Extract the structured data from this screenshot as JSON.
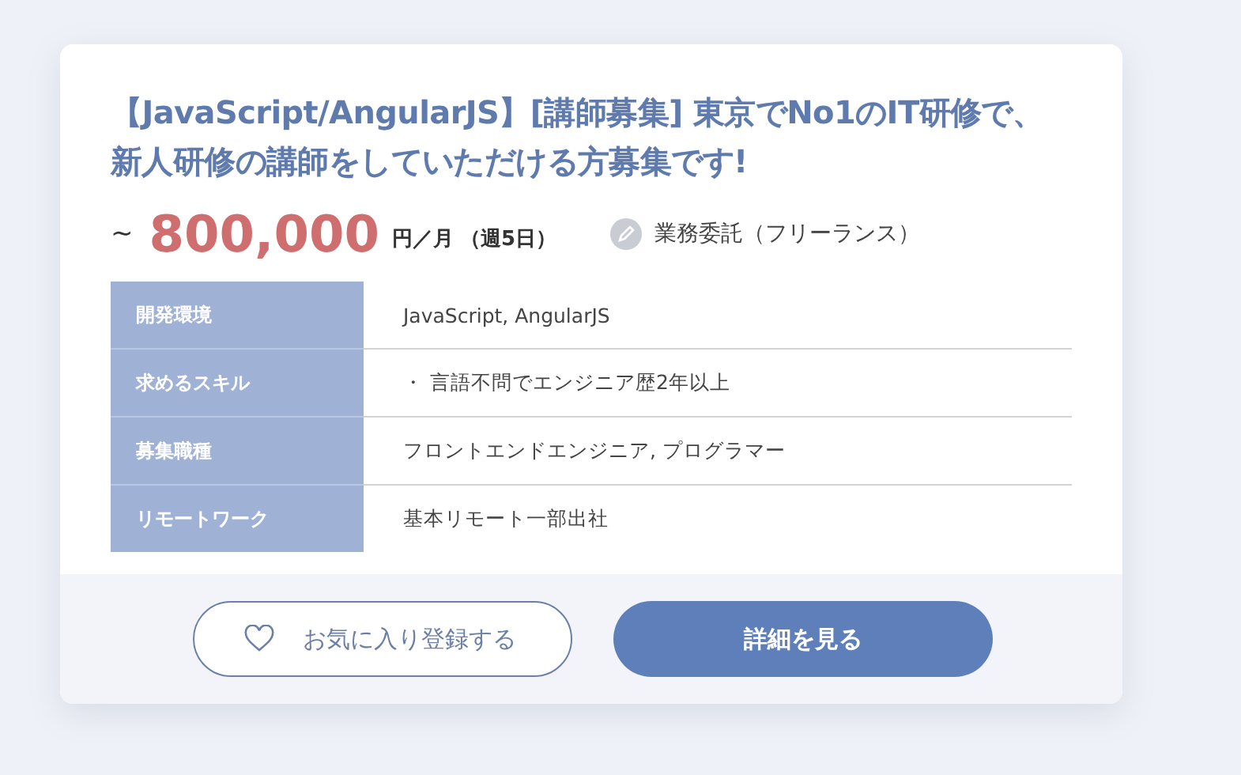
{
  "job": {
    "title": "【JavaScript/AngularJS】[講師募集] 東京でNo1のIT研修で、新人研修の講師をしていただける方募集です!",
    "salary": {
      "prefix": "~",
      "amount": "800,000",
      "unit": "円／月",
      "note": "（週5日）"
    },
    "contract": "業務委託（フリーランス）",
    "details": [
      {
        "label": "開発環境",
        "value": "JavaScript, AngularJS"
      },
      {
        "label": "求めるスキル",
        "value": "・ 言語不問でエンジニア歴2年以上"
      },
      {
        "label": "募集職種",
        "value": "フロントエンドエンジニア, プログラマー"
      },
      {
        "label": "リモートワーク",
        "value": "基本リモート一部出社"
      }
    ],
    "buttons": [
      {
        "kind": "favorite",
        "label": "お気に入り登録する"
      },
      {
        "kind": "primary",
        "label": "詳細を見る"
      }
    ]
  }
}
